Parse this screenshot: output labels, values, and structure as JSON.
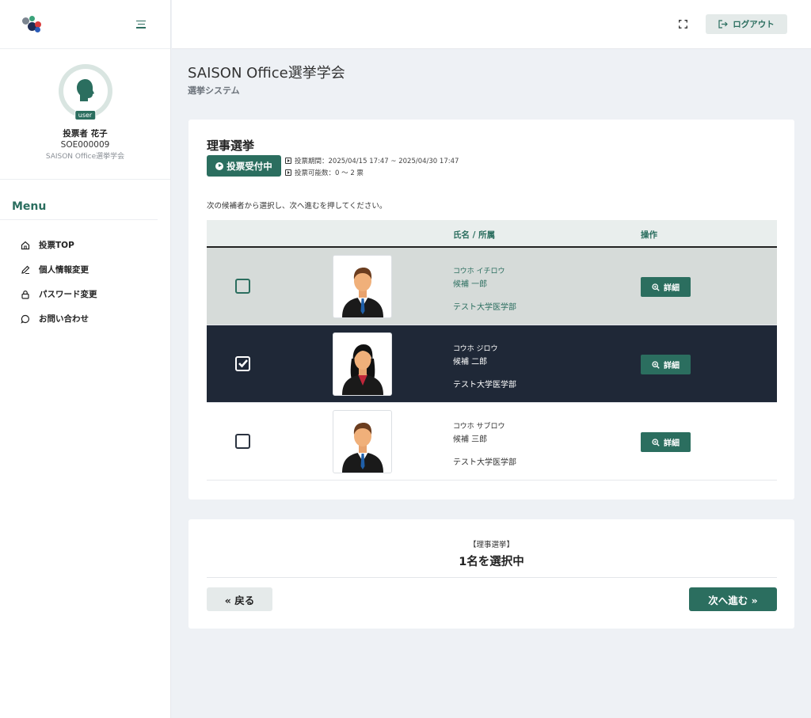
{
  "sidebar": {
    "avatar_badge": "user",
    "profile": {
      "name": "投票者 花子",
      "id": "SOE000009",
      "org": "SAISON Office選挙学会"
    },
    "menu_title": "Menu",
    "menu": [
      {
        "label": "投票TOP",
        "icon": "home-icon"
      },
      {
        "label": "個人情報変更",
        "icon": "pencil-icon"
      },
      {
        "label": "パスワード変更",
        "icon": "lock-icon"
      },
      {
        "label": "お問い合わせ",
        "icon": "chat-icon"
      }
    ]
  },
  "header": {
    "logout_label": "ログアウト"
  },
  "page": {
    "title": "SAISON Office選挙学会",
    "subtitle": "選挙システム"
  },
  "election": {
    "title": "理事選挙",
    "status": "投票受付中",
    "period": "投票期間：2025/04/15 17:47 ~ 2025/04/30 17:47",
    "votes_allowed": "投票可能数：0 〜 2 票",
    "instruction": "次の候補者から選択し、次へ進むを押してください。"
  },
  "table": {
    "col_name": "氏名 / 所属",
    "col_action": "操作",
    "detail_label": "詳細",
    "rows": [
      {
        "kana": "コウホ イチロウ",
        "name": "候補 一郎",
        "dept": "テスト大学医学部",
        "checked": false
      },
      {
        "kana": "コウホ ジロウ",
        "name": "候補 二郎",
        "dept": "テスト大学医学部",
        "checked": true
      },
      {
        "kana": "コウホ サブロウ",
        "name": "候補 三郎",
        "dept": "テスト大学医学部",
        "checked": false
      }
    ]
  },
  "summary": {
    "label": "【理事選挙】",
    "count": "1名を選択中",
    "back_label": "« 戻る",
    "next_label": "次へ進む »"
  },
  "colors": {
    "primary": "#2b6e5f",
    "selected_row": "#1f2837",
    "hover_row": "#d6dbd9",
    "background": "#eef1f5"
  }
}
